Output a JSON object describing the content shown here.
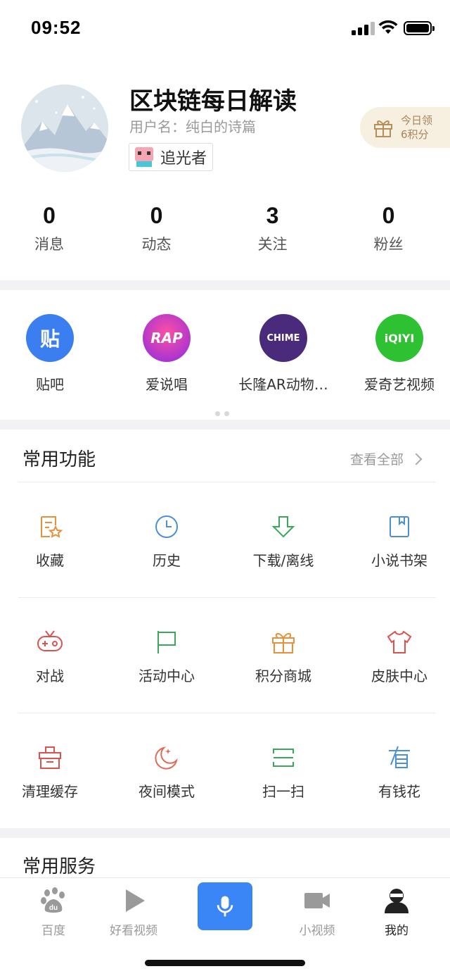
{
  "status_bar": {
    "time": "09:52"
  },
  "profile": {
    "name": "区块链每日解读",
    "username": "用户名：纯白的诗篇",
    "level_badge": "追光者",
    "daily_reward": {
      "line1": "今日领",
      "line2": "6积分"
    },
    "stats": [
      {
        "value": "0",
        "label": "消息"
      },
      {
        "value": "0",
        "label": "动态"
      },
      {
        "value": "3",
        "label": "关注"
      },
      {
        "value": "0",
        "label": "粉丝"
      }
    ]
  },
  "apps": [
    {
      "label": "贴吧",
      "icon_text": "贴",
      "icon": "tieba-icon",
      "color": "#3a7ef0"
    },
    {
      "label": "爱说唱",
      "icon_text": "RAP",
      "icon": "ai-rap-icon",
      "color": "#c53ad4"
    },
    {
      "label": "长隆AR动物…",
      "icon_text": "CHIME",
      "icon": "chimelong-icon",
      "color": "#4a2a7a"
    },
    {
      "label": "爱奇艺视频",
      "icon_text": "iQIYI",
      "icon": "iqiyi-icon",
      "color": "#2ec233"
    }
  ],
  "functions": {
    "title": "常用功能",
    "see_all": "查看全部",
    "items": [
      {
        "label": "收藏",
        "icon": "favorite-icon",
        "color": "#e8913c"
      },
      {
        "label": "历史",
        "icon": "clock-icon",
        "color": "#4a8fd8"
      },
      {
        "label": "下载/离线",
        "icon": "download-icon",
        "color": "#3aa75a"
      },
      {
        "label": "小说书架",
        "icon": "bookshelf-icon",
        "color": "#4a8fd8"
      },
      {
        "label": "对战",
        "icon": "gamepad-icon",
        "color": "#d9534f"
      },
      {
        "label": "活动中心",
        "icon": "flag-icon",
        "color": "#3aa75a"
      },
      {
        "label": "积分商城",
        "icon": "gift-icon",
        "color": "#e8913c"
      },
      {
        "label": "皮肤中心",
        "icon": "shirt-icon",
        "color": "#d9534f"
      },
      {
        "label": "清理缓存",
        "icon": "clean-icon",
        "color": "#d9534f"
      },
      {
        "label": "夜间模式",
        "icon": "moon-icon",
        "color": "#e06a55"
      },
      {
        "label": "扫一扫",
        "icon": "scan-icon",
        "color": "#3aa75a"
      },
      {
        "label": "有钱花",
        "icon": "money-icon",
        "color": "#4a8fd8"
      }
    ]
  },
  "services": {
    "title": "常用服务"
  },
  "tabbar": {
    "items": [
      {
        "label": "百度",
        "icon": "baidu-paw-icon"
      },
      {
        "label": "好看视频",
        "icon": "play-icon"
      },
      {
        "label": "小视频",
        "icon": "video-camera-icon"
      },
      {
        "label": "我的",
        "icon": "user-icon"
      }
    ],
    "active": "我的",
    "accent": "#3b86f6"
  }
}
